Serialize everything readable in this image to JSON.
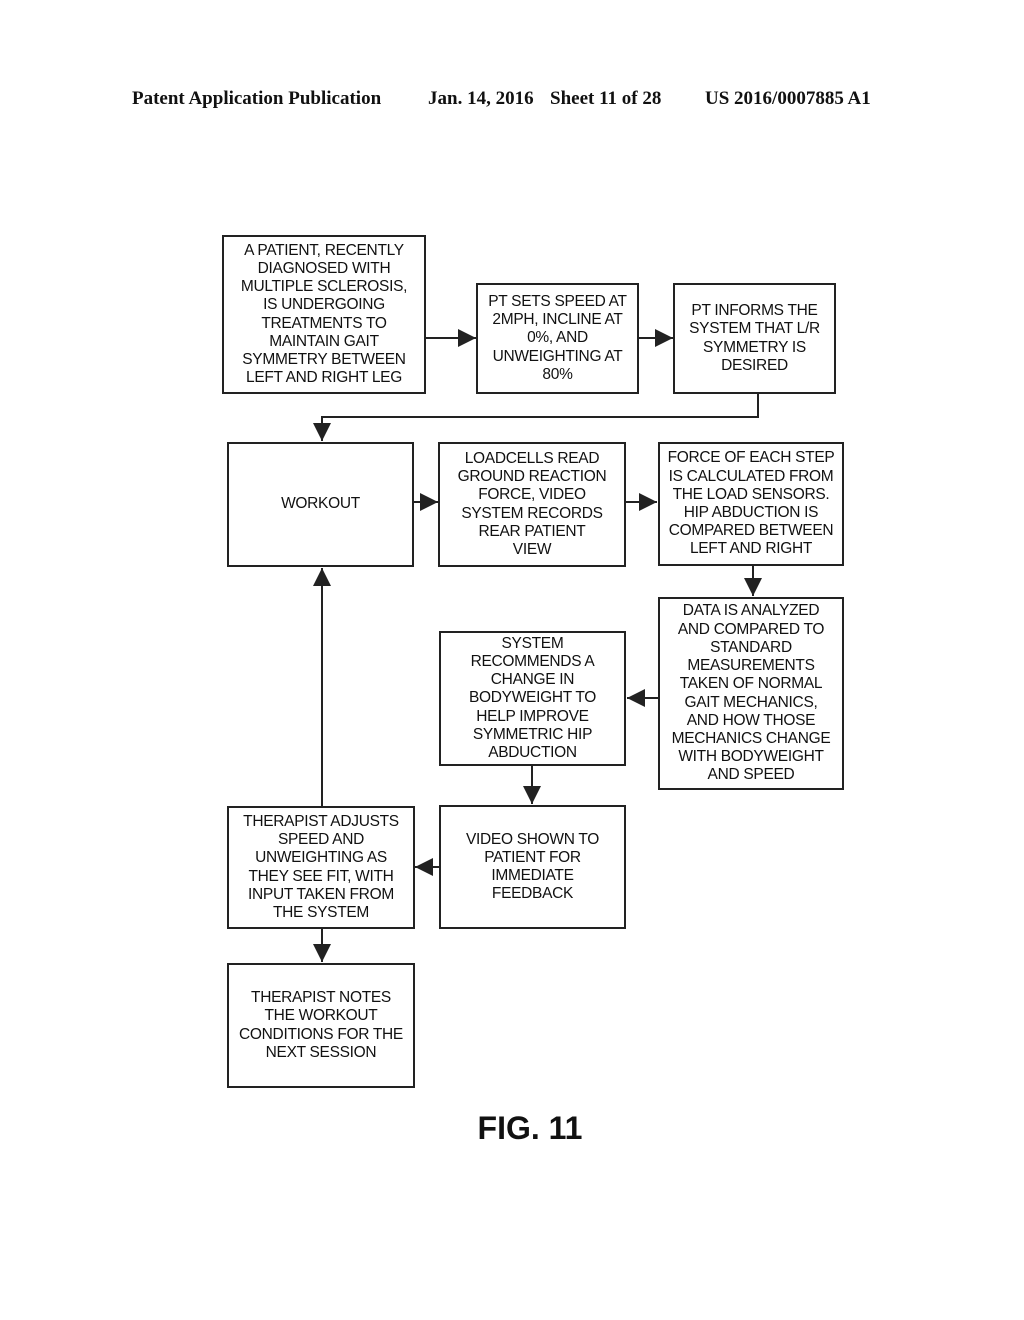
{
  "header": {
    "left": "Patent Application Publication",
    "date": "Jan. 14, 2016",
    "sheet": "Sheet 11 of 28",
    "number": "US 2016/0007885 A1"
  },
  "boxes": {
    "patient": "A PATIENT, RECENTLY\nDIAGNOSED WITH\nMULTIPLE SCLEROSIS,\nIS UNDERGOING\nTREATMENTS TO\nMAINTAIN GAIT\nSYMMETRY BETWEEN\nLEFT AND RIGHT LEG",
    "pt_sets": "PT SETS SPEED AT\n2MPH, INCLINE AT\n0%, AND\nUNWEIGHTING AT\n80%",
    "pt_informs": "PT INFORMS THE\nSYSTEM THAT L/R\nSYMMETRY IS\nDESIRED",
    "workout": "WORKOUT",
    "loadcells": "LOADCELLS READ\nGROUND REACTION\nFORCE, VIDEO\nSYSTEM RECORDS\nREAR PATIENT\nVIEW",
    "force": "FORCE OF EACH STEP\nIS CALCULATED FROM\nTHE LOAD SENSORS.\nHIP ABDUCTION IS\nCOMPARED BETWEEN\nLEFT AND RIGHT",
    "data_analyzed": "DATA IS ANALYZED\nAND COMPARED TO\nSTANDARD\nMEASUREMENTS\nTAKEN OF NORMAL\nGAIT MECHANICS,\nAND HOW THOSE\nMECHANICS CHANGE\nWITH BODYWEIGHT\nAND SPEED",
    "recommends": "SYSTEM\nRECOMMENDS A\nCHANGE IN\nBODYWEIGHT TO\nHELP IMPROVE\nSYMMETRIC HIP\nABDUCTION",
    "video": "VIDEO SHOWN TO\nPATIENT FOR\nIMMEDIATE\nFEEDBACK",
    "therapist_adjusts": "THERAPIST ADJUSTS\nSPEED AND\nUNWEIGHTING AS\nTHEY SEE FIT, WITH\nINPUT TAKEN FROM\nTHE SYSTEM",
    "therapist_notes": "THERAPIST NOTES\nTHE WORKOUT\nCONDITIONS FOR THE\nNEXT SESSION"
  },
  "figure_label": "FIG. 11"
}
